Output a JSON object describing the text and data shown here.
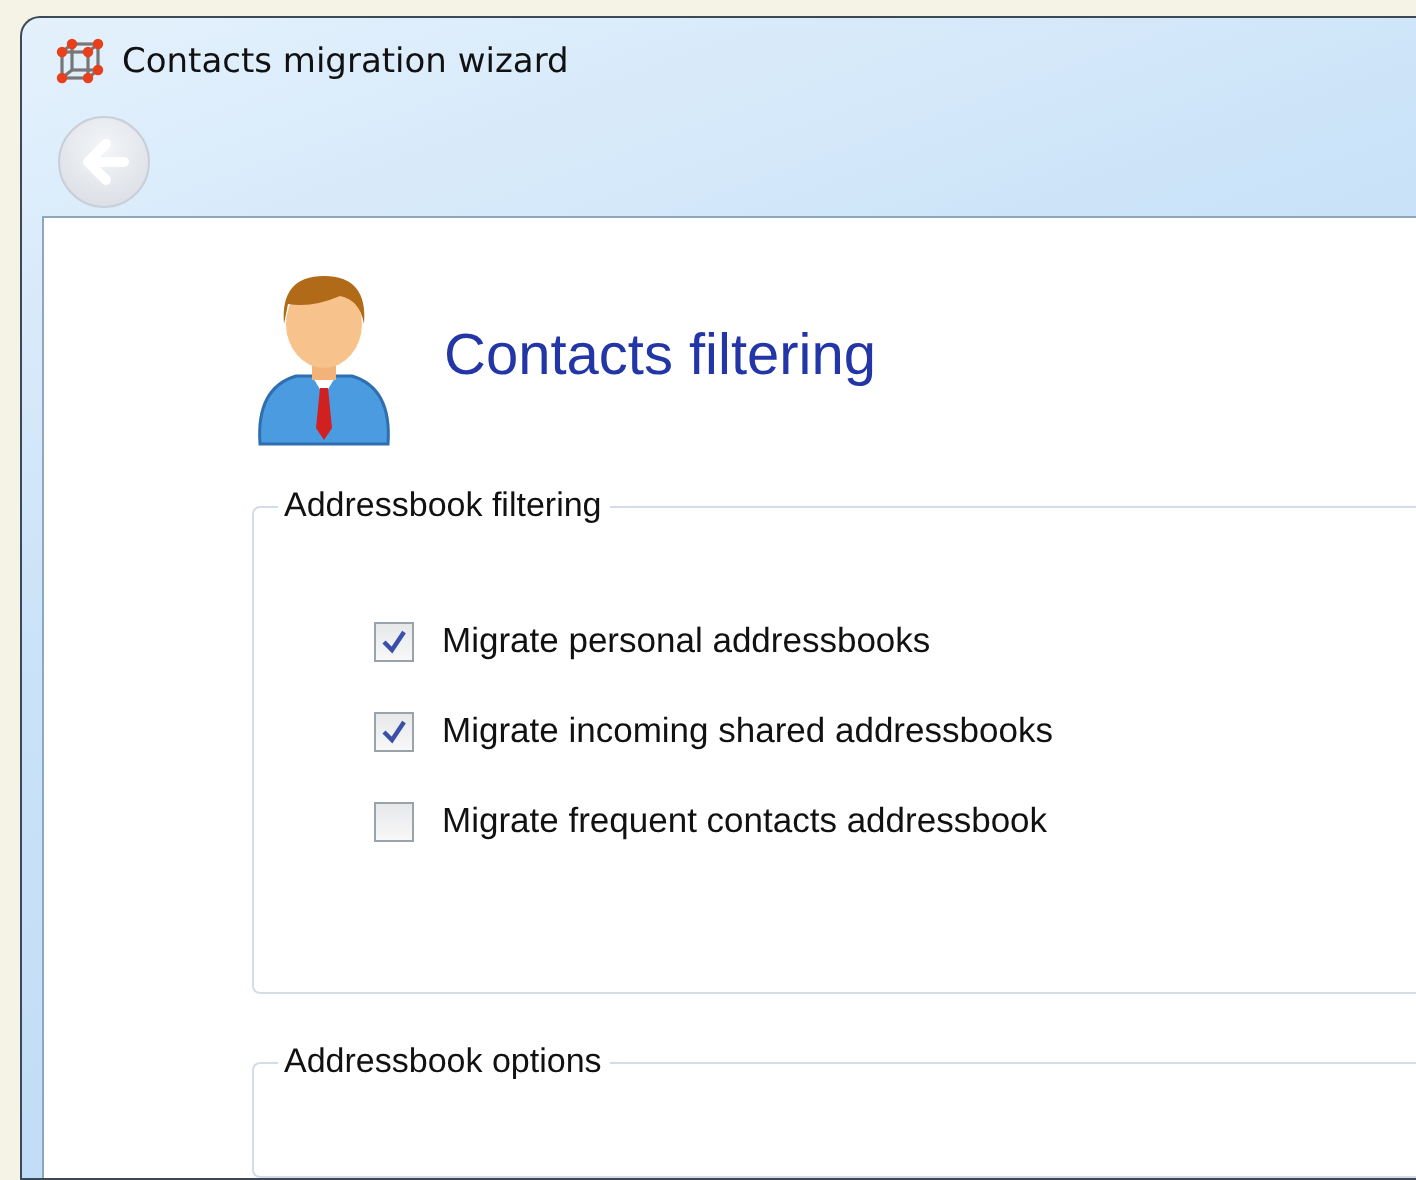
{
  "window": {
    "title": "Contacts migration wizard"
  },
  "page": {
    "heading": "Contacts filtering"
  },
  "groups": [
    {
      "legend": "Addressbook filtering",
      "options": [
        {
          "label": "Migrate personal addressbooks",
          "checked": true
        },
        {
          "label": "Migrate incoming shared addressbooks",
          "checked": true
        },
        {
          "label": "Migrate frequent contacts addressbook",
          "checked": false
        }
      ]
    },
    {
      "legend": "Addressbook options"
    }
  ]
}
